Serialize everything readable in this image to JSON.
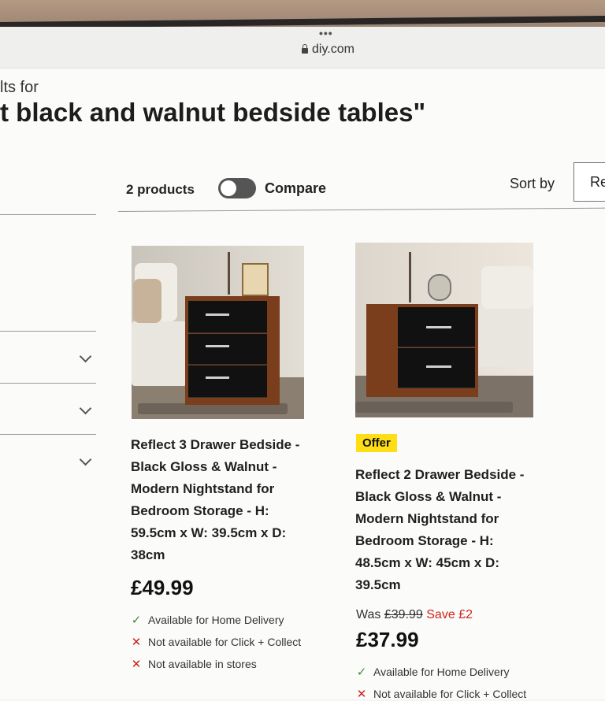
{
  "browser": {
    "url": "diy.com",
    "tab_dots": "•••"
  },
  "search": {
    "results_prefix": "lts for",
    "query_title": "t black and walnut bedside tables\""
  },
  "toolbar": {
    "product_count": "2 products",
    "compare_label": "Compare",
    "compare_on": false,
    "sort_label": "Sort by",
    "sort_value": "Re"
  },
  "products": [
    {
      "title": "Reflect 3 Drawer Bedside - Black Gloss & Walnut - Modern Nightstand for Bedroom Storage - H: 59.5cm x W: 39.5cm x D: 38cm",
      "price": "£49.99",
      "availability": [
        {
          "status": "available",
          "icon": "check-icon",
          "text": "Available for Home Delivery"
        },
        {
          "status": "unavailable",
          "icon": "cross-icon",
          "text": "Not available for Click + Collect"
        },
        {
          "status": "unavailable",
          "icon": "cross-icon",
          "text": "Not available in stores"
        }
      ]
    },
    {
      "badge": "Offer",
      "title": "Reflect 2 Drawer Bedside - Black Gloss & Walnut - Modern Nightstand for Bedroom Storage - H: 48.5cm x W: 45cm x D: 39.5cm",
      "was_label": "Was",
      "was_price": "£39.99",
      "save_text": "Save £2",
      "price": "£37.99",
      "availability": [
        {
          "status": "available",
          "icon": "check-icon",
          "text": "Available for Home Delivery"
        },
        {
          "status": "unavailable",
          "icon": "cross-icon",
          "text": "Not available for Click + Collect"
        }
      ]
    }
  ],
  "colors": {
    "offer_badge": "#ffde15",
    "save_text": "#d0241b",
    "available": "#3b8d3b",
    "unavailable": "#c8211b"
  }
}
